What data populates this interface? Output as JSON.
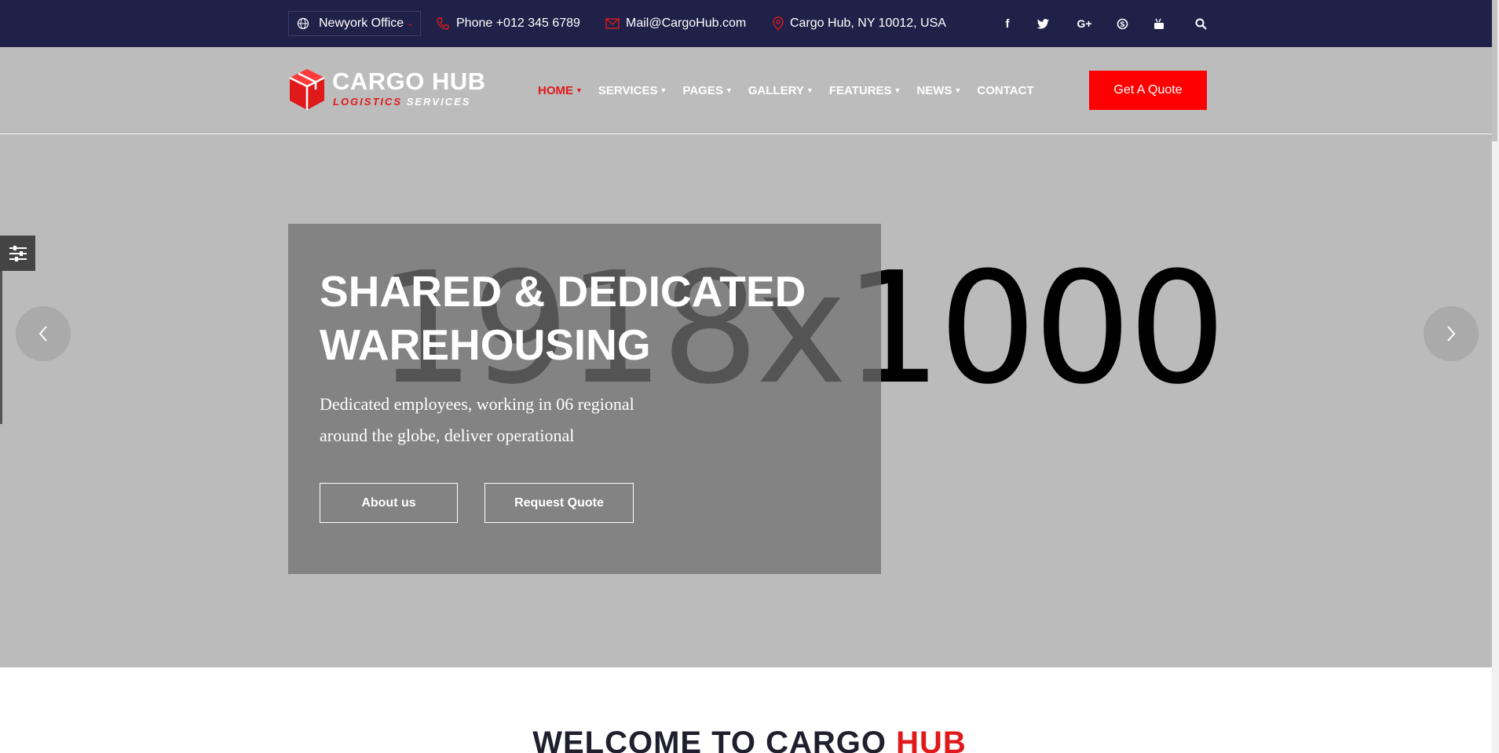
{
  "topbar": {
    "office_select": "Newyork Office",
    "phone": "Phone +012 345 6789",
    "email": "Mail@CargoHub.com",
    "address": "Cargo Hub, NY 10012, USA",
    "social_icons": [
      "facebook-icon",
      "twitter-icon",
      "google-plus-icon",
      "skype-icon",
      "youtube-icon",
      "search-icon"
    ]
  },
  "header": {
    "logo_title": "CARGO HUB",
    "logo_sub_red": "LOGISTICS",
    "logo_sub_white": "SERVICES",
    "nav": [
      {
        "label": "HOME",
        "has_caret": true,
        "active": true
      },
      {
        "label": "SERVICES",
        "has_caret": true,
        "active": false
      },
      {
        "label": "PAGES",
        "has_caret": true,
        "active": false
      },
      {
        "label": "GALLERY",
        "has_caret": true,
        "active": false
      },
      {
        "label": "FEATURES",
        "has_caret": true,
        "active": false
      },
      {
        "label": "NEWS",
        "has_caret": true,
        "active": false
      },
      {
        "label": "CONTACT",
        "has_caret": false,
        "active": false
      }
    ],
    "quote_button": "Get A Quote"
  },
  "hero": {
    "placeholder": "1918x1000",
    "title_line1": "SHARED & DEDICATED",
    "title_line2": "WAREHOUSING",
    "desc_line1": "Dedicated employees, working in 06 regional",
    "desc_line2": "around the globe, deliver operational",
    "btn_about": "About us",
    "btn_request": "Request Quote"
  },
  "welcome": {
    "title_main": "WELCOME TO CARGO ",
    "title_accent": "HUB"
  },
  "colors": {
    "topbar_bg": "#1f2148",
    "accent": "#e0191b",
    "header_bg": "#bcbcbc",
    "hero_bg": "#bbbbbb"
  }
}
